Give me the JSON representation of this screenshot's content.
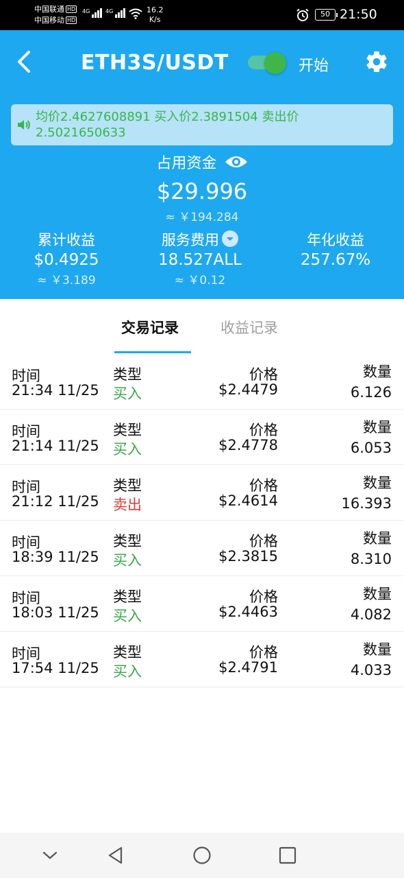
{
  "status_bar": {
    "carrier1": "中国联通",
    "carrier2": "中国移动",
    "hd_badge": "HD",
    "network_type": "4G",
    "speed_value": "16.2",
    "speed_unit": "K/s",
    "battery": "50",
    "time": "21:50"
  },
  "header": {
    "title": "ETH3S/USDT",
    "toggle_label": "开始",
    "toggle_on": true,
    "notice": "均价2.4627608891 买入价2.3891504 卖出价2.5021650633",
    "occupied_label": "占用资金",
    "occupied_value": "$29.996",
    "occupied_cny": "≈ ￥194.284",
    "stats": [
      {
        "label": "累计收益",
        "value": "$0.4925",
        "sub": "≈ ￥3.189"
      },
      {
        "label": "服务费用",
        "value": "18.527ALL",
        "sub": "≈ ￥0.12"
      },
      {
        "label": "年化收益",
        "value": "257.67%",
        "sub": ""
      }
    ]
  },
  "tabs": [
    {
      "label": "交易记录",
      "active": true
    },
    {
      "label": "收益记录",
      "active": false
    }
  ],
  "columns": {
    "time": "时间",
    "type": "类型",
    "price": "价格",
    "qty": "数量"
  },
  "records": [
    {
      "time": "21:34 11/25",
      "type": "买入",
      "side": "buy",
      "price": "$2.4479",
      "qty": "6.126"
    },
    {
      "time": "21:14 11/25",
      "type": "买入",
      "side": "buy",
      "price": "$2.4778",
      "qty": "6.053"
    },
    {
      "time": "21:12 11/25",
      "type": "卖出",
      "side": "sell",
      "price": "$2.4614",
      "qty": "16.393"
    },
    {
      "time": "18:39 11/25",
      "type": "买入",
      "side": "buy",
      "price": "$2.3815",
      "qty": "8.310"
    },
    {
      "time": "18:03 11/25",
      "type": "买入",
      "side": "buy",
      "price": "$2.4463",
      "qty": "4.082"
    },
    {
      "time": "17:54 11/25",
      "type": "买入",
      "side": "buy",
      "price": "$2.4791",
      "qty": "4.033"
    }
  ],
  "colors": {
    "primary": "#1ea8ef",
    "buy": "#3aa84a",
    "sell": "#e53935",
    "notice_bg": "#b6e3f8",
    "notice_text": "#39b54a"
  },
  "icons": [
    "back-icon",
    "toggle-switch",
    "gear-icon",
    "speaker-icon",
    "eye-icon",
    "dropdown-icon",
    "wifi-icon",
    "alarm-icon",
    "nav-collapse-icon",
    "nav-back-icon",
    "nav-home-icon",
    "nav-recent-icon"
  ]
}
